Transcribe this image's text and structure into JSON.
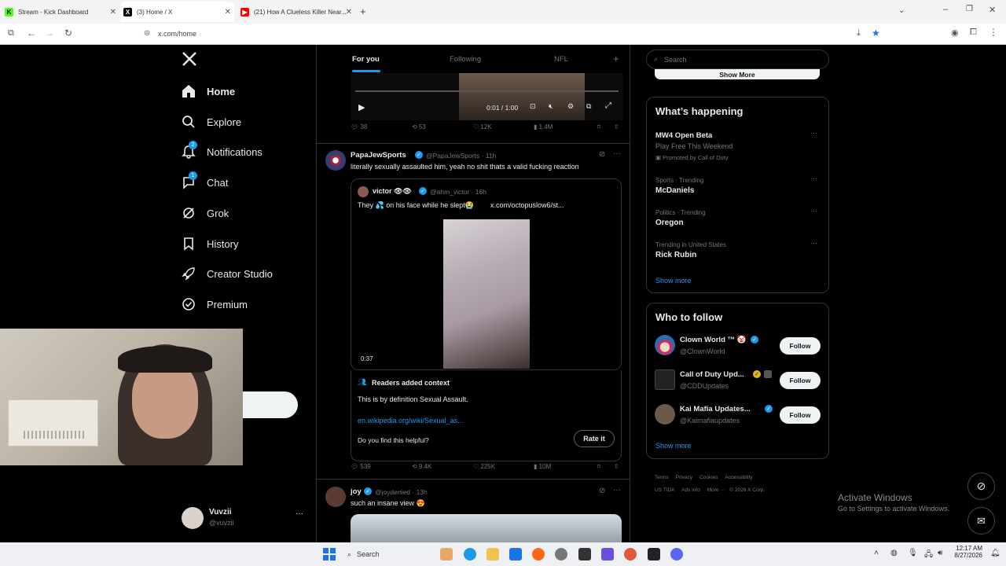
{
  "browser": {
    "tabs": [
      {
        "title": "Stream - Kick Dashboard",
        "icon": "kick-icon",
        "color": "#53fc18"
      },
      {
        "title": "(3) Home / X",
        "icon": "x-logo-icon",
        "color": "#000000"
      },
      {
        "title": "(21) How A Clueless Killer Near...",
        "icon": "youtube-icon",
        "color": "#ff0000"
      }
    ],
    "url": "x.com/home"
  },
  "nav": {
    "items": [
      {
        "label": "Home",
        "icon": "home-icon"
      },
      {
        "label": "Explore",
        "icon": "search-icon"
      },
      {
        "label": "Notifications",
        "icon": "bell-icon",
        "badge": "2"
      },
      {
        "label": "Chat",
        "icon": "chat-icon",
        "badge": "1"
      },
      {
        "label": "Grok",
        "icon": "grok-icon"
      },
      {
        "label": "History",
        "icon": "bookmark-icon"
      },
      {
        "label": "Creator Studio",
        "icon": "rocket-icon"
      },
      {
        "label": "Premium",
        "icon": "verified-icon"
      }
    ],
    "post_button": "t",
    "profile": {
      "name": "Vuvzii",
      "handle": "@vuvzii"
    }
  },
  "feed": {
    "tabs": [
      "For you",
      "Following",
      "NFL"
    ],
    "top_video": {
      "time": "0:01 / 1:00"
    },
    "top_actions": {
      "replies": "38",
      "reposts": "53",
      "likes": "12K",
      "views": "1.4M"
    },
    "post1": {
      "name": "PapaJewSports",
      "meta": "@PapaJewSports · 11h",
      "text": "literally sexually assaulted him, yeah no shit thats a valid fucking reaction",
      "quote": {
        "name": "victor 👁👁",
        "meta": "@ahm_victor · 16h",
        "text": "They 💦 on his face while he slept😭",
        "link": "x.com/octopuslow6/st...",
        "duration": "0:37"
      },
      "context": {
        "title": "Readers added context",
        "body": "This is by definition Sexual Assault.",
        "link": "en.wikipedia.org/wiki/Sexual_as...",
        "question": "Do you find this helpful?",
        "rate": "Rate it"
      },
      "actions": {
        "replies": "539",
        "reposts": "9.4K",
        "likes": "225K",
        "views": "10M"
      }
    },
    "post2": {
      "name": "joy",
      "meta": "@joydenied · 13h",
      "text": "such an insane view 😍"
    }
  },
  "rail": {
    "search_placeholder": "Search",
    "show_more_top": "Show More",
    "happening": {
      "title": "What’s happening",
      "trends": [
        {
          "meta": "",
          "name": "MW4 Open Beta",
          "sub": "Play Free This Weekend",
          "promo": "Promoted by Call of Duty"
        },
        {
          "meta": "Sports · Trending",
          "name": "McDaniels"
        },
        {
          "meta": "Politics · Trending",
          "name": "Oregon"
        },
        {
          "meta": "Trending in United States",
          "name": "Rick Rubin"
        }
      ],
      "show_more": "Show more"
    },
    "who_to_follow": {
      "title": "Who to follow",
      "accounts": [
        {
          "name": "Clown World ™ 🤡",
          "handle": "@ClownWorld",
          "button": "Follow"
        },
        {
          "name": "Call of Duty Upd...",
          "handle": "@CDDUpdates",
          "button": "Follow"
        },
        {
          "name": "Kai Mafia Updates...",
          "handle": "@Kaimafiaupdates",
          "button": "Follow"
        }
      ],
      "show_more": "Show more"
    },
    "footer": [
      "Terms",
      "Privacy",
      "Cookies",
      "Accessibility",
      "US TIDA",
      "Ads info",
      "More ···",
      "© 2026 X Corp."
    ]
  },
  "watermark": {
    "title": "Activate Windows",
    "sub": "Go to Settings to activate Windows."
  },
  "taskbar": {
    "search": "Search",
    "time": "12:17 AM",
    "date": "8/27/2026"
  }
}
